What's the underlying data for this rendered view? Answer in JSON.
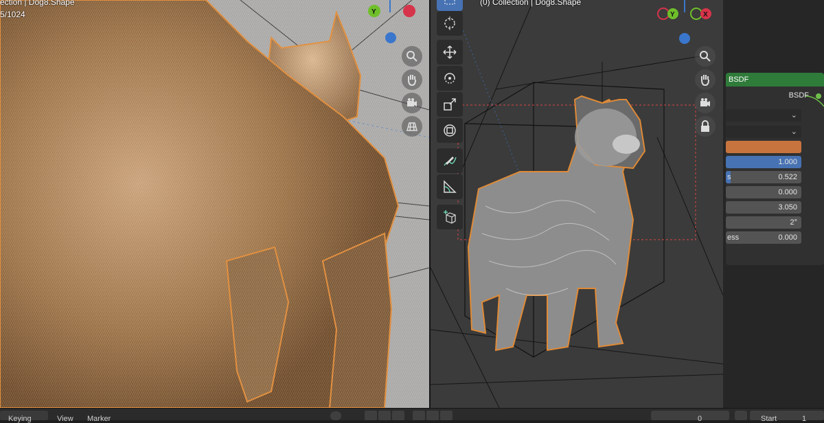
{
  "left_viewport": {
    "header_line1": "ection | Dog8.Shape",
    "header_line2": "5/1024"
  },
  "right_viewport": {
    "header": "(0) Collection | Dog8.Shape"
  },
  "gizmo_axes": {
    "y": "Y",
    "x": "X"
  },
  "nav_icons": [
    "zoom-icon",
    "hand-pan-icon",
    "camera-icon",
    "grid-icon",
    "lock-icon"
  ],
  "tools": [
    "select-box",
    "cursor",
    "move",
    "rotate",
    "scale",
    "transform",
    "annotate",
    "measure",
    "add-cube"
  ],
  "node": {
    "title": "BSDF",
    "output_label": "BSDF",
    "color_swatch": "#c8743e",
    "rows": [
      {
        "label": "",
        "value": "1.000"
      },
      {
        "label": "s",
        "value": "0.522"
      },
      {
        "label": "",
        "value": "0.000"
      },
      {
        "label": "",
        "value": "3.050"
      },
      {
        "label": "",
        "value": "2°"
      },
      {
        "label": "ess",
        "value": "0.000"
      }
    ]
  },
  "timeline": {
    "keying": "Keying",
    "view": "View",
    "marker": "Marker",
    "frame": "0",
    "start_label": "Start",
    "start_value": "1"
  },
  "colors": {
    "accent": "#4772b3",
    "node_header": "#2f7b3a",
    "fur_orange": "#d9883b",
    "axis_y": "#6fbf2a",
    "axis_x": "#d6344a",
    "axis_z": "#3a76cc"
  }
}
